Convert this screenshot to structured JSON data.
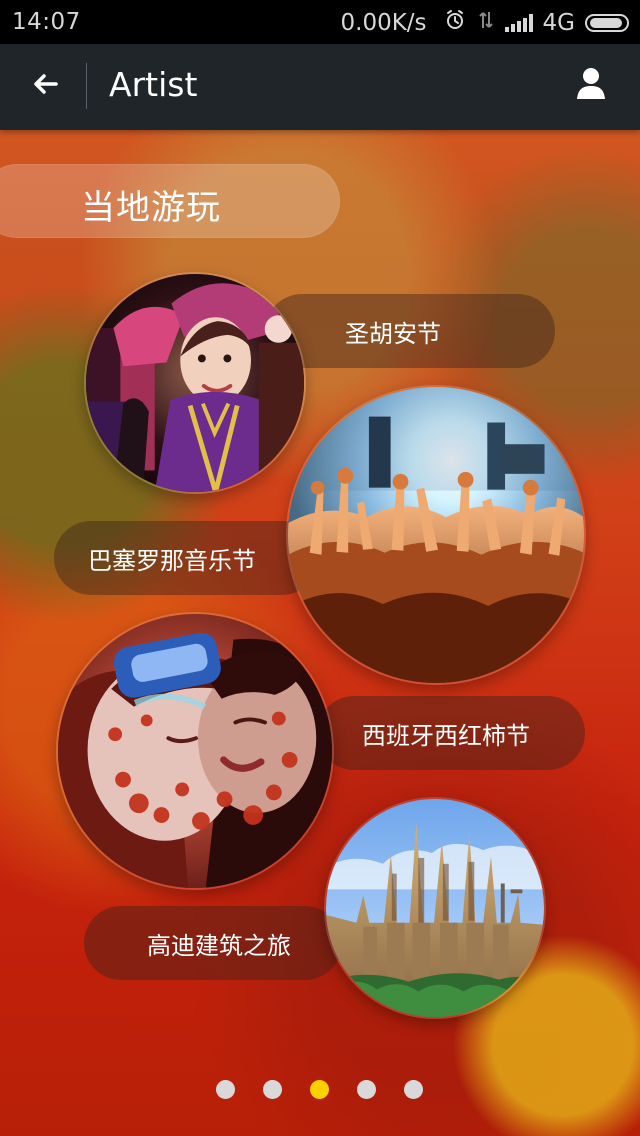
{
  "status_bar": {
    "time": "14:07",
    "network_speed": "0.00K/s",
    "network_type": "4G",
    "icons": [
      "alarm-icon",
      "data-transfer-icon",
      "signal-icon",
      "battery-icon"
    ]
  },
  "header": {
    "title": "Artist",
    "back_icon": "back-arrow-icon",
    "profile_icon": "user-icon"
  },
  "section": {
    "title": "当地游玩"
  },
  "items": [
    {
      "label": "圣胡安节",
      "image": "festival-costume-photo"
    },
    {
      "label": "巴塞罗那音乐节",
      "image": "concert-crowd-photo"
    },
    {
      "label": "西班牙西红柿节",
      "image": "tomato-festival-photo"
    },
    {
      "label": "高迪建筑之旅",
      "image": "sagrada-familia-photo"
    }
  ],
  "pagination": {
    "total_pages": 5,
    "current_page": 3
  },
  "colors": {
    "status_bar": "#000000",
    "app_bar": "#1f2528",
    "active_dot": "#ffd000",
    "inactive_dot": "#d9d9d9"
  }
}
